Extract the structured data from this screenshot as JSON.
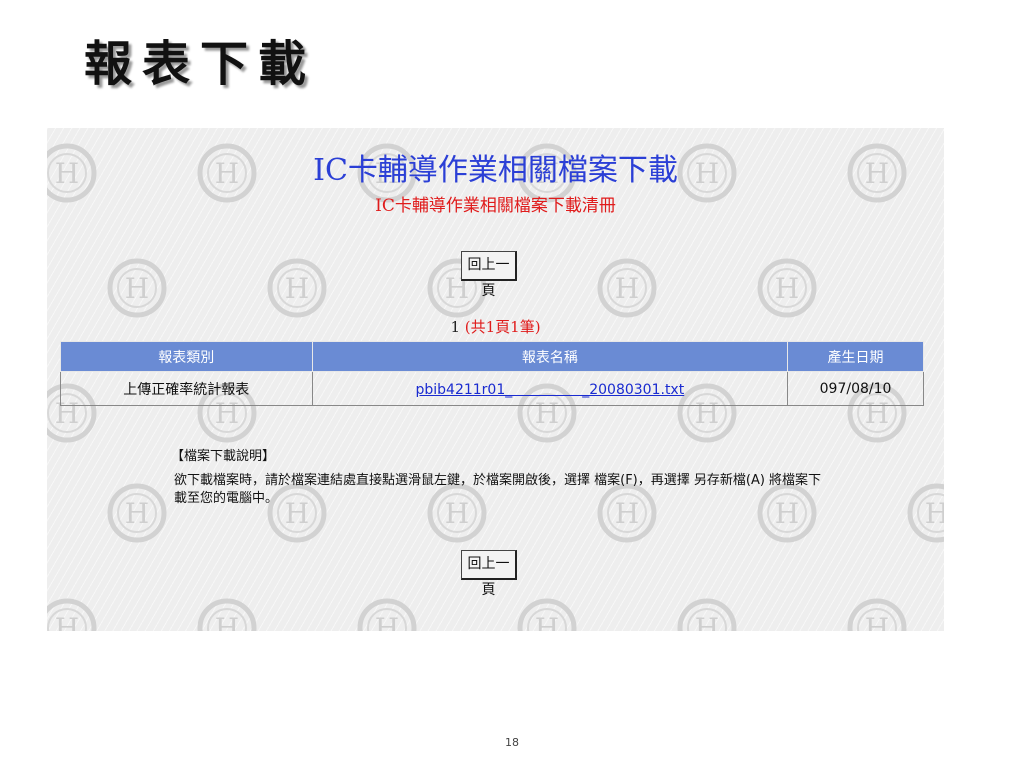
{
  "slide": {
    "title": "報表下載",
    "page_number": "18"
  },
  "app": {
    "heading": "IC卡輔導作業相關檔案下載",
    "subheading": "IC卡輔導作業相關檔案下載清冊",
    "back_button_label": "回上一頁",
    "pager": {
      "page": "1",
      "summary": "(共1頁1筆)"
    },
    "table": {
      "columns": [
        "報表類別",
        "報表名稱",
        "產生日期"
      ],
      "rows": [
        {
          "category": "上傳正確率統計報表",
          "filename": "pbib4211r01_　　　　　_20080301.txt",
          "date": "097/08/10"
        }
      ]
    },
    "note": {
      "title": "【檔案下載說明】",
      "body": "欲下載檔案時，請於檔案連結處直接點選滑鼠左鍵，於檔案開啟後，選擇 檔案(F)，再選擇 另存新檔(A) 將檔案下載至您的電腦中。"
    },
    "colors": {
      "heading": "#2b3fd6",
      "subheading": "#e01b1b",
      "table_header": "#6a8bd4",
      "link": "#1a2bd0"
    }
  }
}
